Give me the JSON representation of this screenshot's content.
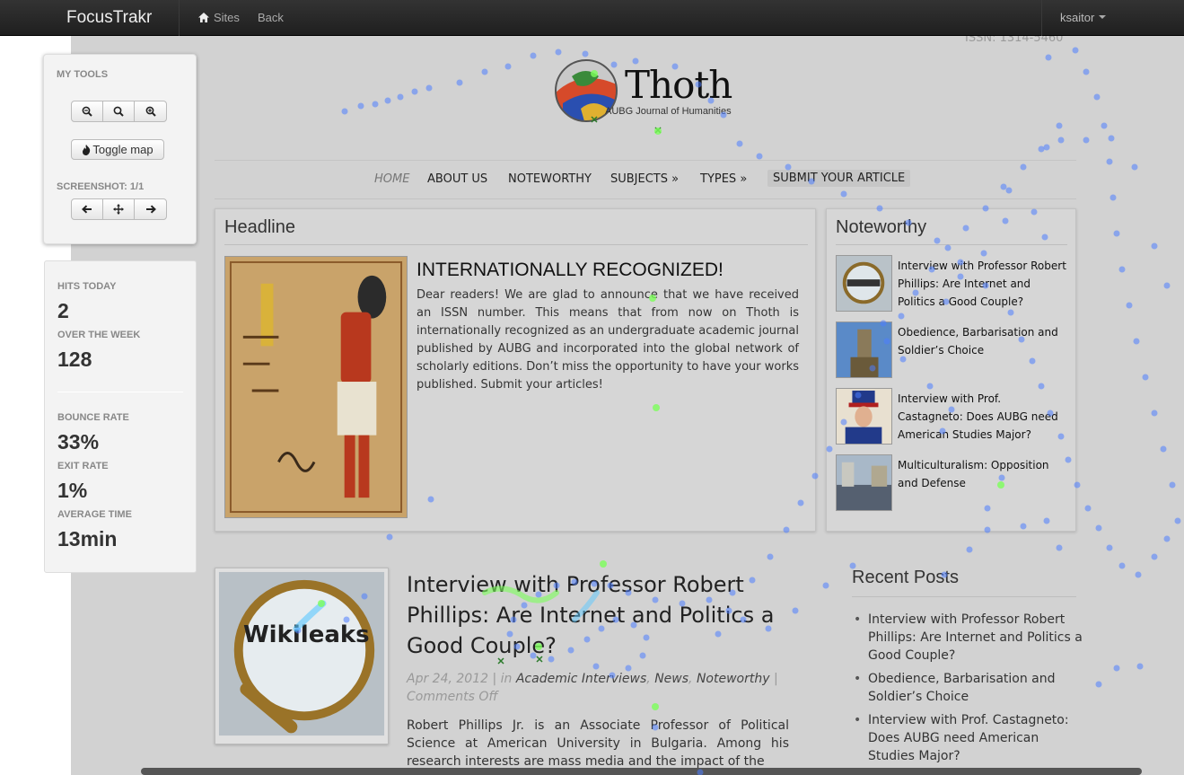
{
  "app": {
    "brand": "FocusTrakr",
    "nav": {
      "sites": "Sites",
      "back": "Back"
    },
    "user": "ksaitor"
  },
  "tools": {
    "title": "MY TOOLS",
    "toggle_map": "Toggle map",
    "screenshot_label": "SCREENSHOT: 1/1"
  },
  "stats": {
    "hits_today_label": "HITS TODAY",
    "hits_today": "2",
    "over_week_label": "OVER THE WEEK",
    "over_week": "128",
    "bounce_rate_label": "BOUNCE RATE",
    "bounce_rate": "33%",
    "exit_rate_label": "EXIT RATE",
    "exit_rate": "1%",
    "average_time_label": "AVERAGE TIME",
    "average_time": "13min"
  },
  "site": {
    "issn": "ISSN: 1314-5460",
    "logo_title": "Thoth",
    "logo_subtitle": "AUBG Journal of Humanities",
    "menu": [
      "HOME",
      "ABOUT US",
      "NOTEWORTHY",
      "SUBJECTS »",
      "TYPES »",
      "SUBMIT YOUR ARTICLE"
    ],
    "headline": {
      "section_title": "Headline",
      "heading": "INTERNATIONALLY RECOGNIZED!",
      "body": "Dear readers! We are glad to announce that we have received an ISSN number. This means that from now on Thoth is internationally recognized as an undergraduate academic journal published by AUBG and incorporated into the global network of scholarly editions. Don’t miss the opportunity to have your works published. Submit your articles!"
    },
    "noteworthy": {
      "section_title": "Noteworthy",
      "items": [
        "Interview with Professor Robert Phillips: Are Internet and Politics a Good Couple?",
        "Obedience, Barbarisation and Soldier’s Choice",
        "Interview with Prof. Castagneto: Does AUBG need American Studies Major?",
        "Multiculturalism: Opposition and Defense"
      ]
    },
    "post": {
      "title": "Interview with Professor Robert Phillips: Are Internet and Politics a Good Couple?",
      "date": "Apr 24, 2012",
      "in": "in",
      "categories": [
        "Academic Interviews",
        "News",
        "Noteworthy"
      ],
      "comments": "Comments Off",
      "excerpt": "Robert Phillips Jr. is an Associate Professor of Political Science at American University in Bulgaria. Among his research interests are mass media and the impact of the",
      "image_label": "Wikileaks"
    },
    "recent_posts": {
      "title": "Recent Posts",
      "items": [
        "Interview with Professor Robert Phillips: Are Internet and Politics a Good Couple?",
        "Obedience, Barbarisation and Soldier’s Choice",
        "Interview with Prof. Castagneto: Does AUBG need American Studies Major?"
      ]
    }
  },
  "colors": {
    "navbar": "#222222",
    "heatmap_dot": "#4d7dff",
    "heatmap_hot": "#7cff5a"
  }
}
